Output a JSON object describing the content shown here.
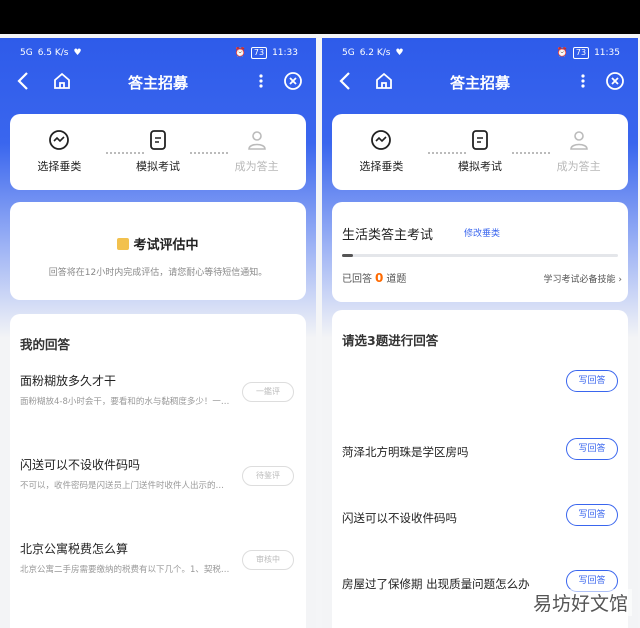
{
  "left": {
    "status": {
      "signal": "5G",
      "speed": "6.5 K/s",
      "battery": "73",
      "time": "11:33"
    },
    "nav": {
      "title": "答主招募"
    },
    "steps": [
      {
        "label": "选择垂类",
        "icon": "chart-face-icon",
        "active": true
      },
      {
        "label": "模拟考试",
        "icon": "document-icon",
        "active": true
      },
      {
        "label": "成为答主",
        "icon": "person-icon",
        "active": false
      }
    ],
    "evaluation": {
      "title": "考试评估中",
      "subtitle": "回答将在12小时内完成评估，请您耐心等待短信通知。"
    },
    "answers": {
      "heading": "我的回答",
      "items": [
        {
          "question": "面粉糊放多久才干",
          "desc": "面粉糊放4-8小时会干，要看和的水与黏稠度多少！一…",
          "tag": "一鑑评"
        },
        {
          "question": "闪送可以不设收件码吗",
          "desc": "不可以，收件密码是闪送员上门送件时收件人出示的…",
          "tag": "待鉴评"
        },
        {
          "question": "北京公寓税费怎么算",
          "desc": "北京公寓二手房需要缴纳的税费有以下几个。1、契税…",
          "tag": "审核中"
        }
      ]
    }
  },
  "right": {
    "status": {
      "signal": "5G",
      "speed": "6.2 K/s",
      "battery": "73",
      "time": "11:35"
    },
    "nav": {
      "title": "答主招募"
    },
    "steps": [
      {
        "label": "选择垂类",
        "icon": "chart-face-icon",
        "active": true
      },
      {
        "label": "模拟考试",
        "icon": "document-icon",
        "active": true
      },
      {
        "label": "成为答主",
        "icon": "person-icon",
        "active": false
      }
    ],
    "exam": {
      "title": "生活类答主考试",
      "edit": "修改垂类",
      "progress": 0.02,
      "answered_prefix": "已回答",
      "answered_count": "0",
      "answered_suffix": "道题",
      "skill_link": "学习考试必备技能"
    },
    "pick": {
      "heading": "请选3题进行回答",
      "button": "写回答",
      "items": [
        {
          "question": ""
        },
        {
          "question": "菏泽北方明珠是学区房吗"
        },
        {
          "question": "闪送可以不设收件码吗"
        },
        {
          "question": "房屋过了保修期 出现质量问题怎么办"
        }
      ]
    }
  },
  "watermark": "易坊好文馆",
  "colors": {
    "brand": "#3a66ee",
    "accent": "#ff6a00"
  }
}
